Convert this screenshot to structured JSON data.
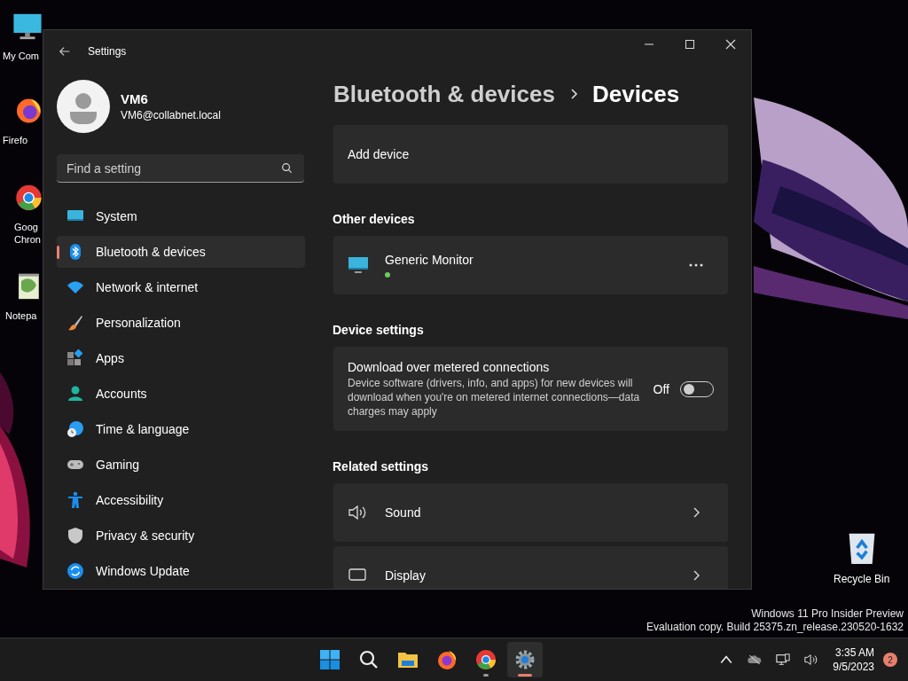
{
  "desktop_icons": [
    {
      "lines": [
        "My Com"
      ]
    },
    {
      "lines": [
        "Firefo"
      ]
    },
    {
      "lines": [
        "Goog",
        "Chron"
      ]
    },
    {
      "lines": [
        "Notepa"
      ]
    }
  ],
  "recycle_bin": {
    "label": "Recycle Bin"
  },
  "window": {
    "title": "Settings"
  },
  "profile": {
    "name": "VM6",
    "email": "VM6@collabnet.local"
  },
  "search": {
    "placeholder": "Find a setting"
  },
  "nav": [
    {
      "label": "System",
      "selected": false
    },
    {
      "label": "Bluetooth & devices",
      "selected": true
    },
    {
      "label": "Network & internet",
      "selected": false
    },
    {
      "label": "Personalization",
      "selected": false
    },
    {
      "label": "Apps",
      "selected": false
    },
    {
      "label": "Accounts",
      "selected": false
    },
    {
      "label": "Time & language",
      "selected": false
    },
    {
      "label": "Gaming",
      "selected": false
    },
    {
      "label": "Accessibility",
      "selected": false
    },
    {
      "label": "Privacy & security",
      "selected": false
    },
    {
      "label": "Windows Update",
      "selected": false
    }
  ],
  "breadcrumb": {
    "parent": "Bluetooth & devices",
    "current": "Devices"
  },
  "add_device": {
    "label": "Add device"
  },
  "other_devices": {
    "heading": "Other devices",
    "devices": [
      {
        "name": "Generic Monitor",
        "connected": true
      }
    ]
  },
  "device_settings": {
    "heading": "Device settings",
    "items": [
      {
        "title": "Download over metered connections",
        "description": "Device software (drivers, info, and apps) for new devices will download when you're on metered internet connections—data charges may apply",
        "state_label": "Off",
        "on": false
      }
    ]
  },
  "related_settings": {
    "heading": "Related settings",
    "items": [
      {
        "label": "Sound"
      },
      {
        "label": "Display"
      }
    ]
  },
  "watermark": [
    "Windows 11 Pro Insider Preview",
    "Evaluation copy. Build 25375.zn_release.230520-1632"
  ],
  "taskbar": {
    "apps": [
      {
        "selected": false,
        "running": false
      },
      {
        "selected": false,
        "running": false
      },
      {
        "selected": false,
        "running": false
      },
      {
        "selected": false,
        "running": false
      },
      {
        "selected": false,
        "running": true
      },
      {
        "selected": true,
        "running": true
      }
    ],
    "time": "3:35 AM",
    "date": "9/5/2023",
    "notifications": "2"
  }
}
